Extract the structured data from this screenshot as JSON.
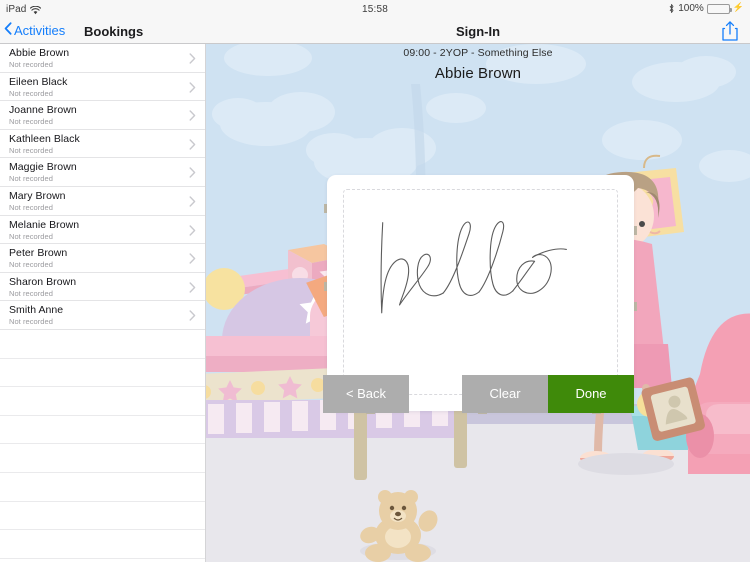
{
  "statusbar": {
    "device": "iPad",
    "wifi_icon": "wifi-icon",
    "time": "15:58",
    "bluetooth_icon": "bluetooth-icon",
    "battery_percent": "100%",
    "battery_icon": "battery-full-icon",
    "charging_icon": "plug-icon"
  },
  "navbar": {
    "back_label": "Activities",
    "back_chevron_icon": "chevron-left-icon",
    "sidebar_title": "Bookings",
    "detail_title": "Sign-In",
    "share_icon": "share-icon"
  },
  "sidebar": {
    "subtitle_default": "Not recorded",
    "chevron_icon": "chevron-right-icon",
    "items": [
      {
        "name": "Abbie Brown",
        "status": "Not recorded"
      },
      {
        "name": "Eileen Black",
        "status": "Not recorded"
      },
      {
        "name": "Joanne Brown",
        "status": "Not recorded"
      },
      {
        "name": "Kathleen Black",
        "status": "Not recorded"
      },
      {
        "name": "Maggie Brown",
        "status": "Not recorded"
      },
      {
        "name": "Mary Brown",
        "status": "Not recorded"
      },
      {
        "name": "Melanie Brown",
        "status": "Not recorded"
      },
      {
        "name": "Peter Brown",
        "status": "Not recorded"
      },
      {
        "name": "Sharon Brown",
        "status": "Not recorded"
      },
      {
        "name": "Smith Anne",
        "status": "Not recorded"
      }
    ],
    "empty_row_count": 8
  },
  "detail": {
    "booking_line": "09:00 - 2YOP - Something Else",
    "person_name": "Abbie Brown",
    "signature_text": "hello",
    "signature_pad_name": "signature-canvas",
    "background_scene": "nursery-playroom-illustration"
  },
  "buttons": {
    "back": "< Back",
    "clear": "Clear",
    "done": "Done"
  },
  "colors": {
    "accent_blue": "#147efb",
    "done_green": "#3f8a0a",
    "button_grey": "#adadad",
    "battery_green": "#4cd964",
    "sky_blue": "#cfe2f2",
    "floor_grey": "#e8e7ec"
  }
}
